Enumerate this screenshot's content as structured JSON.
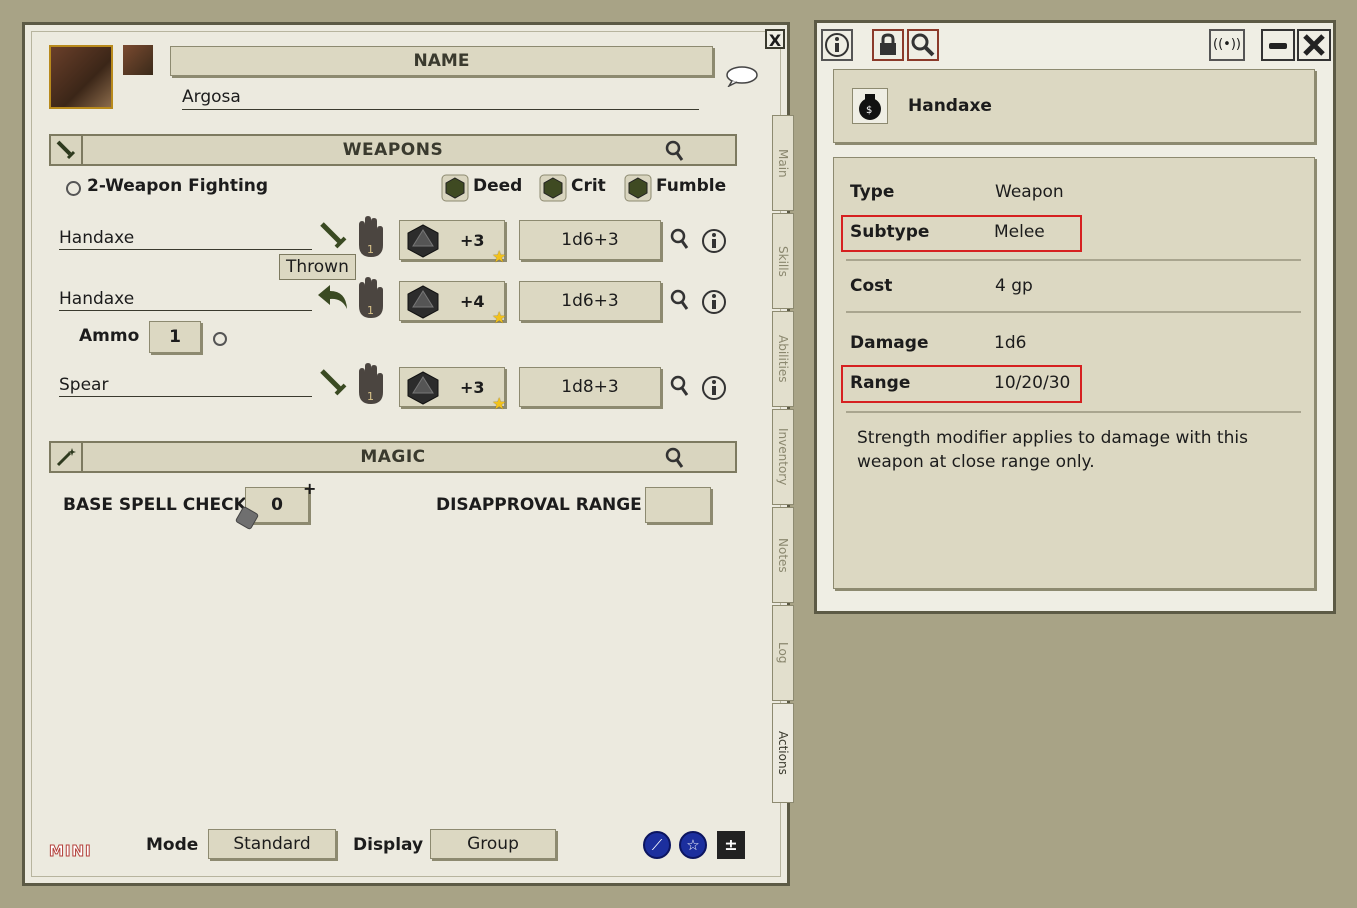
{
  "sheet": {
    "name_label": "NAME",
    "name_value": "Argosa",
    "weapons_header": "WEAPONS",
    "magic_header": "MAGIC",
    "two_weapon": "2-Weapon Fighting",
    "deed": "Deed",
    "crit": "Crit",
    "fumble": "Fumble",
    "weapons": [
      {
        "name": "Handaxe",
        "attack": "+3",
        "damage": "1d6+3",
        "hand_num": "1"
      },
      {
        "name": "Handaxe",
        "attack": "+4",
        "damage": "1d6+3",
        "hand_num": "1"
      },
      {
        "name": "Spear",
        "attack": "+3",
        "damage": "1d8+3",
        "hand_num": "1"
      }
    ],
    "tooltip": "Thrown",
    "ammo_label": "Ammo",
    "ammo_value": "1",
    "base_spell_check_label": "BASE SPELL CHECK",
    "base_spell_check_value": "0",
    "disapproval_label": "DISAPPROVAL RANGE",
    "disapproval_value": "",
    "mini_logo": "MINI",
    "mode_label": "Mode",
    "mode_value": "Standard",
    "display_label": "Display",
    "display_value": "Group",
    "close_glyph": "X",
    "tabs": [
      "Main",
      "Skills",
      "Abilities",
      "Inventory",
      "Notes",
      "Log",
      "Actions"
    ],
    "active_tab": "Actions"
  },
  "record": {
    "title": "Handaxe",
    "fields": {
      "type_label": "Type",
      "type_value": "Weapon",
      "subtype_label": "Subtype",
      "subtype_value": "Melee",
      "cost_label": "Cost",
      "cost_value": "4 gp",
      "damage_label": "Damage",
      "damage_value": "1d6",
      "range_label": "Range",
      "range_value": "10/20/30"
    },
    "description": "Strength modifier applies to damage with this weapon at close range only."
  },
  "colors": {
    "background": "#a8a386",
    "panel": "#eceadf",
    "highlight": "#d62020",
    "die": "#4a4a2a",
    "star": "#f2c21b"
  }
}
